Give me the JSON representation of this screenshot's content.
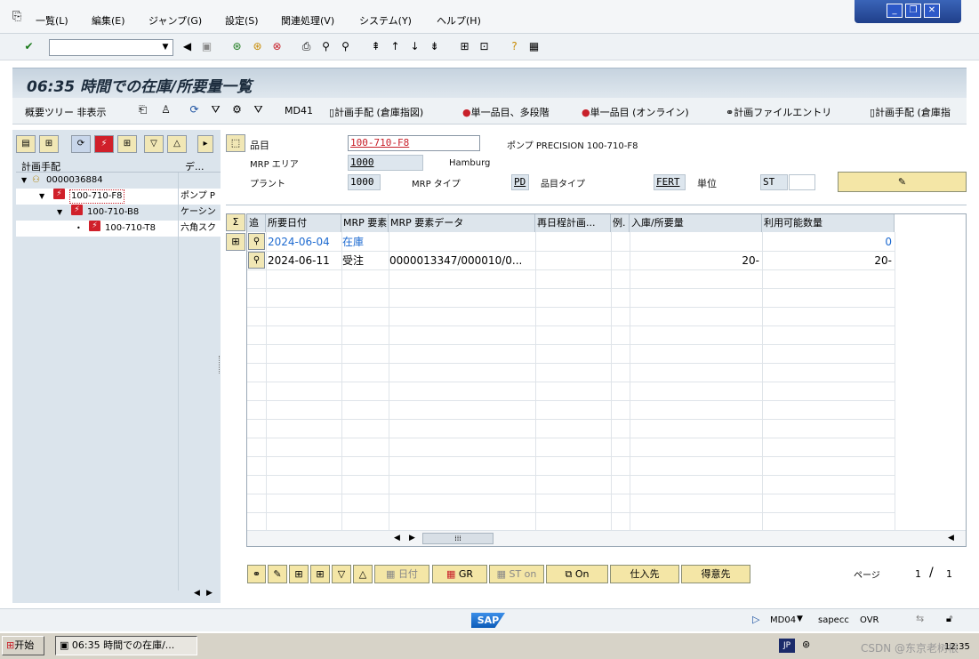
{
  "menu": [
    "一覧(L)",
    "編集(E)",
    "ジャンプ(G)",
    "設定(S)",
    "関連処理(V)",
    "システム(Y)",
    "ヘルプ(H)"
  ],
  "title": "06:35 時間での在庫/所要量一覧",
  "app_toolbar": {
    "hide_tree": "概要ツリー 非表示",
    "md41": "MD41",
    "plan_order": "計画手配 (倉庫指図)",
    "single_multi": "単一品目、多段階",
    "single_online": "単一品目 (オンライン)",
    "plan_file": "計画ファイルエントリ",
    "plan_order2": "計画手配 (倉庫指"
  },
  "tree": {
    "col1": "計画手配",
    "col2": "デ...",
    "rows": [
      {
        "id": "0000036884",
        "desc": ""
      },
      {
        "id": "100-710-F8",
        "desc": "ポンプ P"
      },
      {
        "id": "100-710-B8",
        "desc": "ケーシン"
      },
      {
        "id": "100-710-T8",
        "desc": "六角スク"
      }
    ]
  },
  "header": {
    "material_label": "品目",
    "material": "100-710-F8",
    "material_desc": "ポンプ PRECISION 100-710-F8",
    "mrp_area_label": "MRP エリア",
    "mrp_area": "1000",
    "mrp_area_desc": "Hamburg",
    "plant_label": "プラント",
    "plant": "1000",
    "mrp_type_label": "MRP タイプ",
    "mrp_type": "PD",
    "mat_type_label": "品目タイプ",
    "mat_type": "FERT",
    "unit_label": "単位",
    "unit": "ST"
  },
  "grid": {
    "columns": [
      "追",
      "所要日付",
      "MRP 要素",
      "MRP 要素データ",
      "再日程計画...",
      "例.",
      "入庫/所要量",
      "利用可能数量"
    ],
    "rows": [
      {
        "date": "2024-06-04",
        "elem": "在庫",
        "data": "",
        "qty": "",
        "avail": "0"
      },
      {
        "date": "2024-06-11",
        "elem": "受注",
        "data": "0000013347/000010/0...",
        "qty": "20-",
        "avail": "20-"
      }
    ]
  },
  "bottom": {
    "date_btn": "日付",
    "gr": "GR",
    "st_on": "ST on",
    "on": "On",
    "vendor": "仕入先",
    "customer": "得意先",
    "page_label": "ページ",
    "page": "1",
    "page_total": "1"
  },
  "status": {
    "tcode": "MD04",
    "server": "sapecc",
    "mode": "OVR"
  },
  "taskbar": {
    "start": "开始",
    "task": "06:35 時間での在庫/...",
    "lang": "JP",
    "time": "12:35",
    "watermark": "CSDN @东京老树根"
  }
}
